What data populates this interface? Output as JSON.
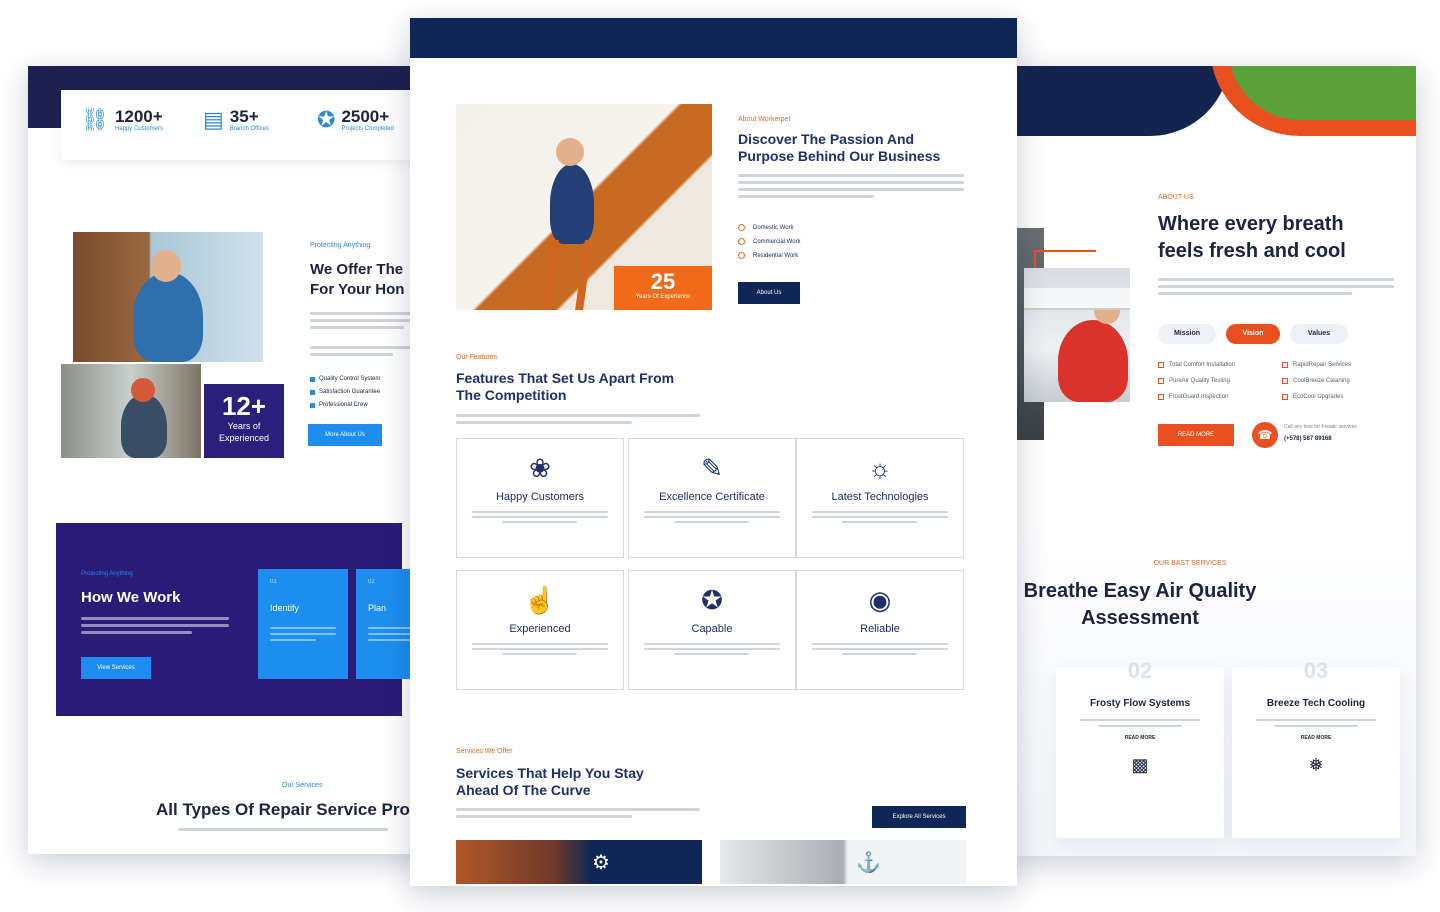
{
  "left": {
    "stats": [
      {
        "icon": "network-icon",
        "value": "1200+",
        "label": "Happy Customers"
      },
      {
        "icon": "building-icon",
        "value": "35+",
        "label": "Branch Offices"
      },
      {
        "icon": "badge-icon",
        "value": "2500+",
        "label": "Projects Completed"
      }
    ],
    "badge_big": "12+",
    "badge_small": "Years of Experienced",
    "eyebrow": "Protecting Anything",
    "heading_line1": "We Offer The",
    "heading_line2": "For Your Hon",
    "checklist": [
      "Quality Control System",
      "Satisfaction Guarantee",
      "Professional Crew"
    ],
    "more_button": "More About Us",
    "work_eyebrow": "Protecting Anything",
    "work_title": "How We Work",
    "view_button": "View Services",
    "steps": [
      {
        "n": "01",
        "label": "Identify"
      },
      {
        "n": "02",
        "label": "Plan"
      }
    ],
    "services_eyebrow": "Our Services",
    "services_title": "All Types Of Repair Service Prov"
  },
  "center": {
    "badge_big": "25",
    "badge_small": "Years Of Experience",
    "about_eyebrow": "About Workerpet",
    "about_title_1": "Discover The Passion And",
    "about_title_2": "Purpose Behind Our Business",
    "bullets": [
      "Domestic Work",
      "Commercial Work",
      "Residential Work"
    ],
    "about_button": "About Us",
    "features_eyebrow": "Our Features",
    "features_title_1": "Features That Set Us Apart From",
    "features_title_2": "The Competition",
    "features": [
      {
        "icon": "hands-icon",
        "title": "Happy Customers"
      },
      {
        "icon": "certificate-icon",
        "title": "Excellence Certificate"
      },
      {
        "icon": "lightbulb-icon",
        "title": "Latest Technologies"
      },
      {
        "icon": "thumbs-up-icon",
        "title": "Experienced"
      },
      {
        "icon": "medal-icon",
        "title": "Capable"
      },
      {
        "icon": "shield-icon",
        "title": "Reliable"
      }
    ],
    "services_eyebrow": "Services We Offer",
    "services_title_1": "Services That Help You Stay",
    "services_title_2": "Ahead Of The Curve",
    "explore_button": "Explore All Services"
  },
  "right": {
    "eyebrow": "ABOUT US",
    "heading_line1": "Where every breath",
    "heading_line2": "feels fresh and cool",
    "tabs": [
      "Mission",
      "Vision",
      "Values"
    ],
    "checks_left": [
      "Total Comfort Installation",
      "PureAir Quality Testing",
      "FrostGuard Inspection"
    ],
    "checks_right": [
      "RapidRepair Services",
      "CoolBreeze Cleaning",
      "EcoCool Upgrades"
    ],
    "read_more": "READ MORE",
    "call_text": "Call any time for Fresair services",
    "phone": "(+578) 587 89168",
    "services_eyebrow": "OUR BAST SERVICES",
    "services_title_1": "Breathe Easy Air Quality",
    "services_title_2": "Assessment",
    "cards": [
      {
        "num": "02",
        "title": "Frosty Flow Systems",
        "read_more": "READ MORE"
      },
      {
        "num": "03",
        "title": "Breeze Tech Cooling",
        "read_more": "READ MORE"
      }
    ]
  },
  "colors": {
    "navy": "#0f2756",
    "orange": "#f06a1a",
    "blue": "#1d8ef0",
    "purple": "#2a1b78"
  }
}
